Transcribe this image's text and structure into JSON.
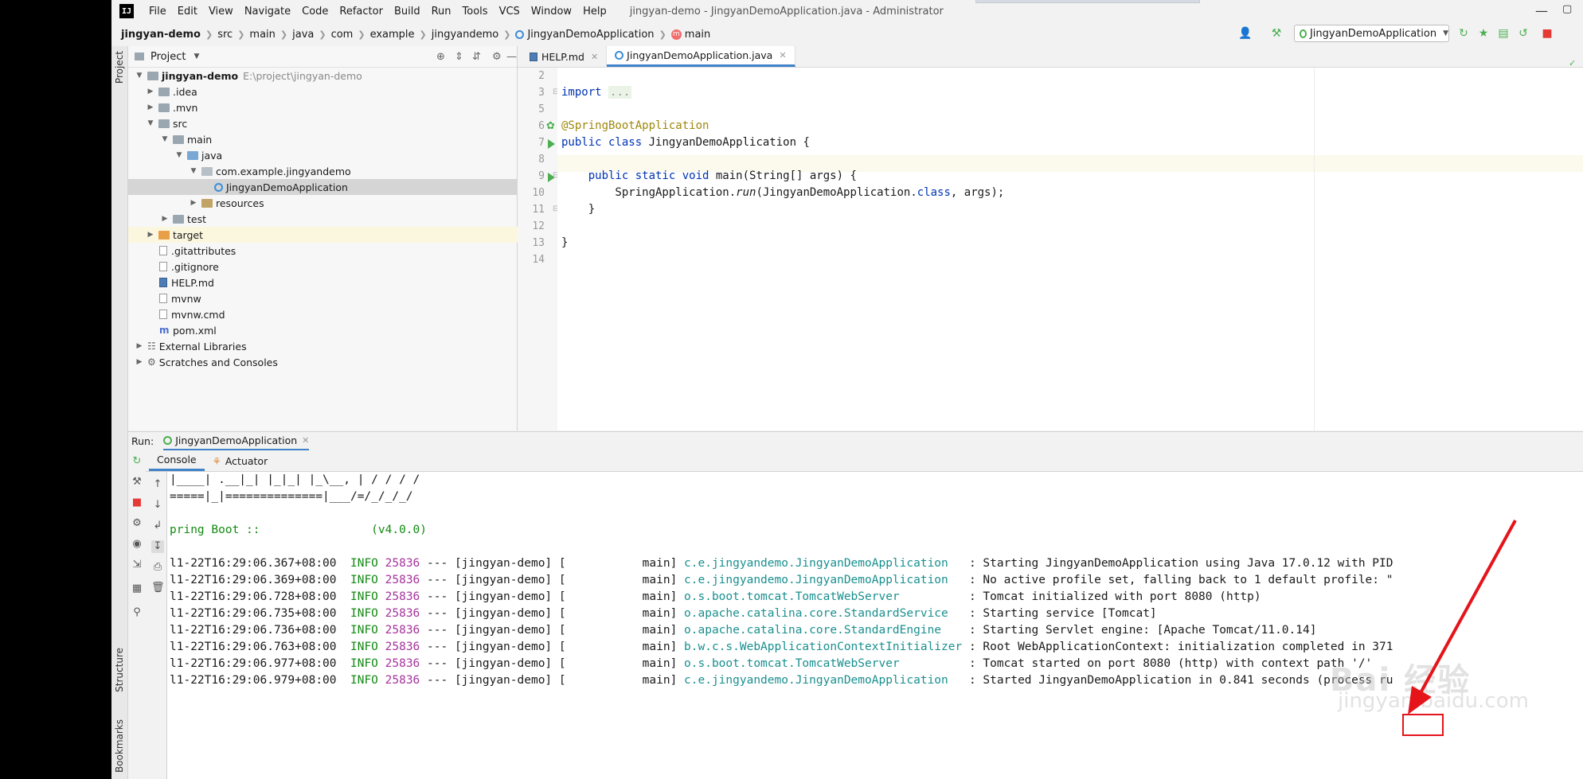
{
  "menubar": {
    "logo": "IJ",
    "items": [
      "File",
      "Edit",
      "View",
      "Navigate",
      "Code",
      "Refactor",
      "Build",
      "Run",
      "Tools",
      "VCS",
      "Window",
      "Help"
    ],
    "window_title": "jingyan-demo - JingyanDemoApplication.java - Administrator"
  },
  "navbar": {
    "crumbs": [
      "jingyan-demo",
      "src",
      "main",
      "java",
      "com",
      "example",
      "jingyandemo",
      "JingyanDemoApplication",
      "main"
    ],
    "run_config": "JingyanDemoApplication"
  },
  "left_strip": {
    "project": "Project",
    "structure": "Structure",
    "bookmarks": "Bookmarks"
  },
  "project_panel": {
    "title": "Project",
    "tree": [
      {
        "label": "jingyan-demo",
        "extra": "E:\\project\\jingyan-demo"
      },
      {
        "label": ".idea"
      },
      {
        "label": ".mvn"
      },
      {
        "label": "src"
      },
      {
        "label": "main"
      },
      {
        "label": "java"
      },
      {
        "label": "com.example.jingyandemo"
      },
      {
        "label": "JingyanDemoApplication"
      },
      {
        "label": "resources"
      },
      {
        "label": "test"
      },
      {
        "label": "target"
      },
      {
        "label": ".gitattributes"
      },
      {
        "label": ".gitignore"
      },
      {
        "label": "HELP.md"
      },
      {
        "label": "mvnw"
      },
      {
        "label": "mvnw.cmd"
      },
      {
        "label": "pom.xml"
      },
      {
        "label": "External Libraries"
      },
      {
        "label": "Scratches and Consoles"
      }
    ]
  },
  "editor": {
    "tabs": [
      "HELP.md",
      "JingyanDemoApplication.java"
    ],
    "line_numbers": [
      "2",
      "3",
      "5",
      "6",
      "7",
      "8",
      "9",
      "10",
      "11",
      "12",
      "13",
      "14"
    ],
    "code": {
      "l3_kw": "import",
      "l3_fold": "...",
      "l6": "@SpringBootApplication",
      "l7_kw": "public class",
      "l7_rest": " JingyanDemoApplication {",
      "l9_kw": "    public static void",
      "l9_rest": " main(String[] args) {",
      "l10_a": "        SpringApplication.",
      "l10_b": "run",
      "l10_c": "(JingyanDemoApplication.",
      "l10_d": "class",
      "l10_e": ", args);",
      "l11": "    }",
      "l13": "}"
    }
  },
  "run_panel": {
    "label": "Run:",
    "config": "JingyanDemoApplication",
    "tabs": [
      "Console",
      "Actuator"
    ],
    "banner": [
      "|____| .__|_| |_|_| |_\\__, | / / / /",
      "=====|_|==============|___/=/_/_/_/",
      "",
      "pring Boot ::                (v4.0.0)"
    ],
    "logs": [
      {
        "ts": "l1-22T16:29:06.367+08:00",
        "level": "INFO",
        "pid": "25836",
        "mid": " --- [jingyan-demo] [           main] ",
        "cls": "c.e.jingyandemo.JingyanDemoApplication  ",
        "msg": " : Starting JingyanDemoApplication using Java 17.0.12 with PID"
      },
      {
        "ts": "l1-22T16:29:06.369+08:00",
        "level": "INFO",
        "pid": "25836",
        "mid": " --- [jingyan-demo] [           main] ",
        "cls": "c.e.jingyandemo.JingyanDemoApplication  ",
        "msg": " : No active profile set, falling back to 1 default profile: \""
      },
      {
        "ts": "l1-22T16:29:06.728+08:00",
        "level": "INFO",
        "pid": "25836",
        "mid": " --- [jingyan-demo] [           main] ",
        "cls": "o.s.boot.tomcat.TomcatWebServer         ",
        "msg": " : Tomcat initialized with port 8080 (http)"
      },
      {
        "ts": "l1-22T16:29:06.735+08:00",
        "level": "INFO",
        "pid": "25836",
        "mid": " --- [jingyan-demo] [           main] ",
        "cls": "o.apache.catalina.core.StandardService  ",
        "msg": " : Starting service [Tomcat]"
      },
      {
        "ts": "l1-22T16:29:06.736+08:00",
        "level": "INFO",
        "pid": "25836",
        "mid": " --- [jingyan-demo] [           main] ",
        "cls": "o.apache.catalina.core.StandardEngine   ",
        "msg": " : Starting Servlet engine: [Apache Tomcat/11.0.14]"
      },
      {
        "ts": "l1-22T16:29:06.763+08:00",
        "level": "INFO",
        "pid": "25836",
        "mid": " --- [jingyan-demo] [           main] ",
        "cls": "b.w.c.s.WebApplicationContextInitializer",
        "msg": " : Root WebApplicationContext: initialization completed in 371"
      },
      {
        "ts": "l1-22T16:29:06.977+08:00",
        "level": "INFO",
        "pid": "25836",
        "mid": " --- [jingyan-demo] [           main] ",
        "cls": "o.s.boot.tomcat.TomcatWebServer         ",
        "msg": " : Tomcat started on port 8080 (http) with context path '/'"
      },
      {
        "ts": "l1-22T16:29:06.979+08:00",
        "level": "INFO",
        "pid": "25836",
        "mid": " --- [jingyan-demo] [           main] ",
        "cls": "c.e.jingyandemo.JingyanDemoApplication  ",
        "msg": " : Started JingyanDemoApplication in 0.841 seconds (process ru"
      }
    ]
  },
  "watermark": {
    "line1": "Bai 经验",
    "line2": "jingyan.baidu.com"
  },
  "colors": {
    "accent": "#4083c9",
    "highlight": "#e5141b",
    "log_green": "#128a12",
    "pid_purple": "#a4349c",
    "class_teal": "#1a8f8f"
  }
}
